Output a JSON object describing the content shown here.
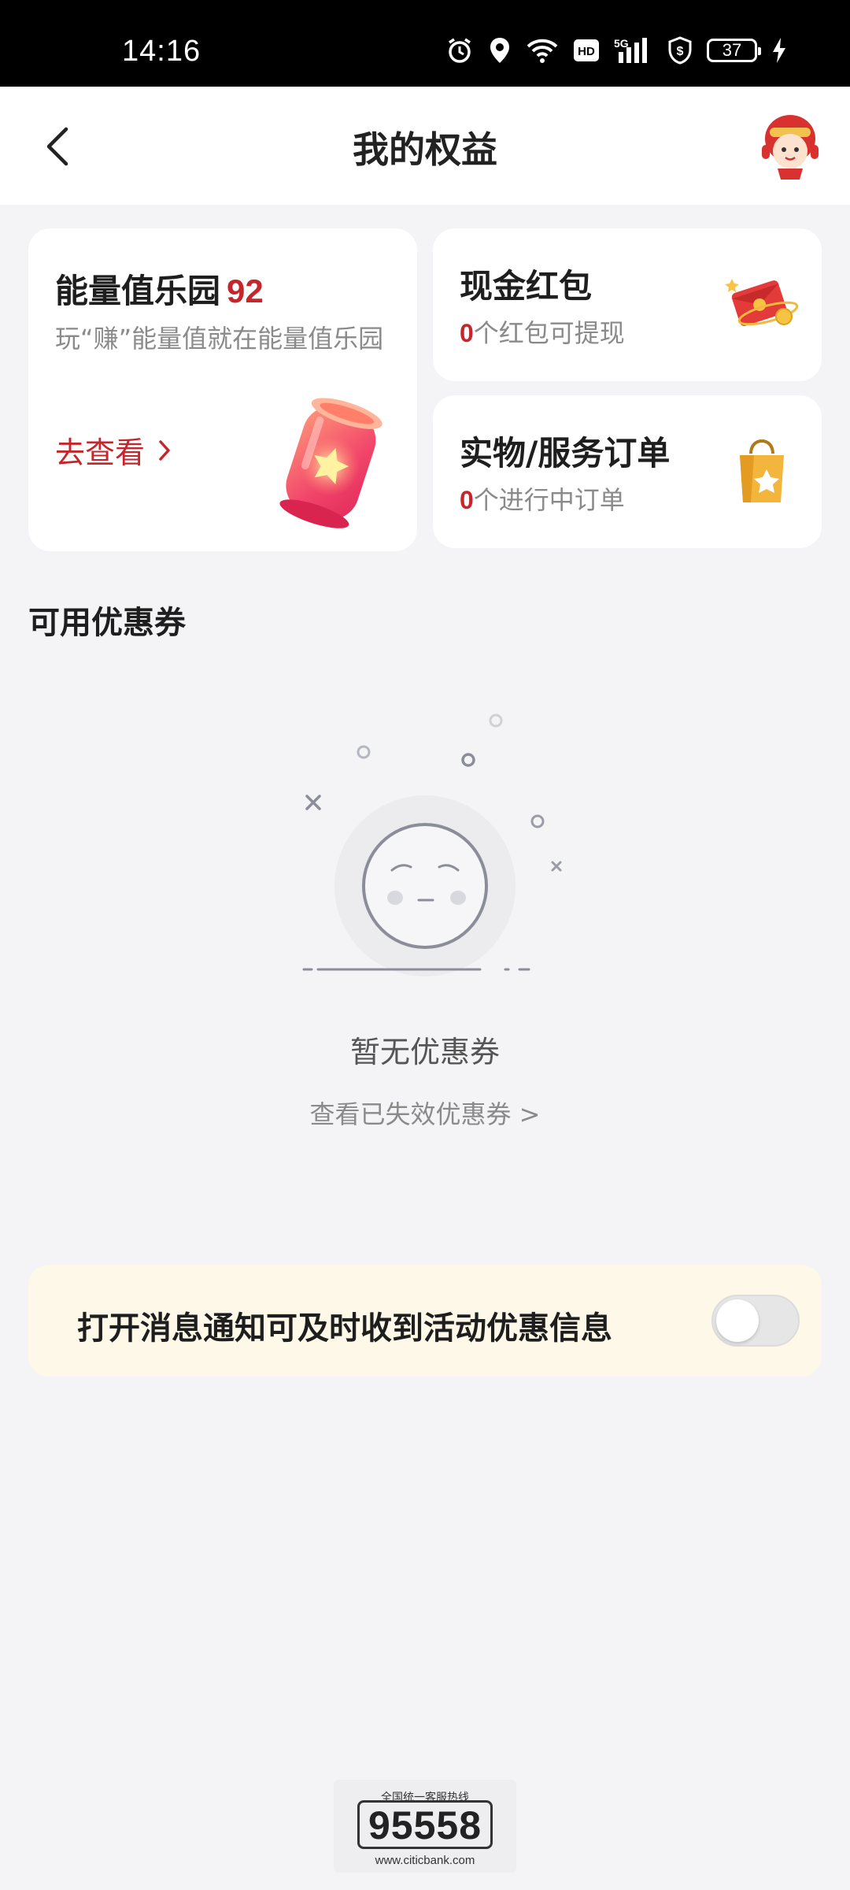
{
  "status_bar": {
    "time": "14:16",
    "battery": "37",
    "icons": [
      "alarm-icon",
      "location-icon",
      "wifi-icon",
      "hd-icon",
      "5g-signal-icon",
      "vpn-shield-icon",
      "battery-icon",
      "charging-icon"
    ],
    "hd_label": "HD",
    "signal_label": "5G"
  },
  "header": {
    "title": "我的权益",
    "back_icon": "chevron-left-icon"
  },
  "energy_card": {
    "title": "能量值乐园",
    "value": "92",
    "description": "玩“赚”能量值就在能量值乐园",
    "link": "去查看",
    "link_icon": "chevron-right-icon"
  },
  "cash_card": {
    "title": "现金红包",
    "count": "0",
    "subtitle": "个红包可提现"
  },
  "order_card": {
    "title": "实物/服务订单",
    "count": "0",
    "subtitle": "个进行中订单"
  },
  "coupons": {
    "section_title": "可用优惠券",
    "empty_text": "暂无优惠券",
    "expired_link": "查看已失效优惠券 >"
  },
  "notice": {
    "text": "打开消息通知可及时收到活动优惠信息",
    "toggle_on": false
  },
  "hotline": {
    "caption": "全国统一客服热线",
    "number": "95558",
    "site": "www.citicbank.com"
  },
  "colors": {
    "accent": "#c5262c",
    "background": "#f4f4f6",
    "notice_bg": "#fdf8e7"
  }
}
